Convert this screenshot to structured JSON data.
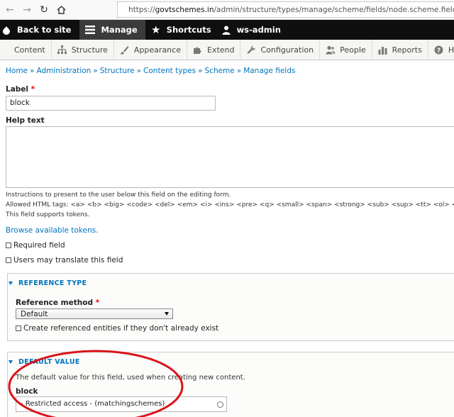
{
  "browser": {
    "url_prefix": "https://",
    "url_host": "govtschemes.in",
    "url_path": "/admin/structure/types/manage/scheme/fields/node.scheme.field_block"
  },
  "toolbar": {
    "back_to_site": "Back to site",
    "manage": "Manage",
    "shortcuts": "Shortcuts",
    "user": "ws-admin"
  },
  "tray": {
    "items": [
      "Content",
      "Structure",
      "Appearance",
      "Extend",
      "Configuration",
      "People",
      "Reports",
      "Help"
    ]
  },
  "breadcrumb": [
    "Home",
    "Administration",
    "Structure",
    "Content types",
    "Scheme",
    "Manage fields"
  ],
  "breadcrumb_sep": "»",
  "form": {
    "label_label": "Label",
    "required_marker": "*",
    "label_value": "block",
    "help_text_label": "Help text",
    "help_desc_1": "Instructions to present to the user below this field on the editing form.",
    "help_desc_2": "Allowed HTML tags: <a> <b> <big> <code> <del> <em> <i> <ins> <pre> <q> <small> <span> <strong> <sub> <sup> <tt> <ol> <ul> <",
    "help_desc_3": "This field supports tokens.",
    "browse_tokens": "Browse available tokens.",
    "required_field": "Required field",
    "translate_field": "Users may translate this field"
  },
  "reference_type": {
    "legend": "REFERENCE TYPE",
    "method_label": "Reference method",
    "method_value": "Default",
    "create_entities": "Create referenced entities if they don't already exist"
  },
  "default_value": {
    "legend": "DEFAULT VALUE",
    "description": "The default value for this field, used when creating new content.",
    "block_label": "block",
    "block_value": "- Restricted access - (matchingschemes)"
  },
  "colors": {
    "link": "#0074bd",
    "toolbar_bg": "#0f0f0f",
    "annotation": "#d9141b"
  }
}
